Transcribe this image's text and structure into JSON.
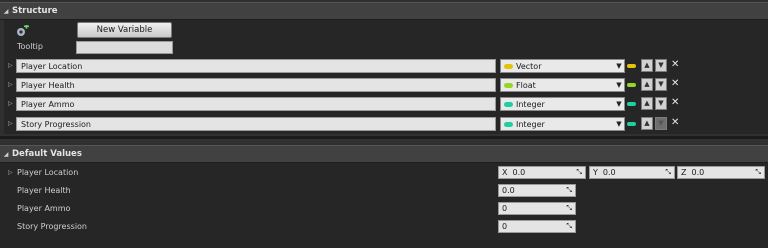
{
  "structure": {
    "title": "Structure",
    "new_variable_label": "New Variable",
    "tooltip_label": "Tooltip",
    "tooltip_value": "",
    "variables": [
      {
        "name": "Player Location",
        "type": "Vector",
        "color": "#e5c30b"
      },
      {
        "name": "Player Health",
        "type": "Float",
        "color": "#96d625"
      },
      {
        "name": "Player Ammo",
        "type": "Integer",
        "color": "#1ed0a0"
      },
      {
        "name": "Story Progression",
        "type": "Integer",
        "color": "#1ed0a0"
      }
    ]
  },
  "defaults": {
    "title": "Default Values",
    "player_location": {
      "label": "Player Location",
      "x_axis": "X",
      "x": "0.0",
      "y_axis": "Y",
      "y": "0.0",
      "z_axis": "Z",
      "z": "0.0"
    },
    "player_health": {
      "label": "Player Health",
      "value": "0.0"
    },
    "player_ammo": {
      "label": "Player Ammo",
      "value": "0"
    },
    "story_progression": {
      "label": "Story Progression",
      "value": "0"
    }
  },
  "icons": {
    "collapse": "triangle-down-icon",
    "expand": "triangle-right-icon",
    "add": "add-variable-icon",
    "move_up": "arrow-up-icon",
    "move_down": "arrow-down-icon",
    "delete": "close-icon",
    "dropdown": "chevron-down-icon",
    "grip": "resize-grip-icon"
  }
}
